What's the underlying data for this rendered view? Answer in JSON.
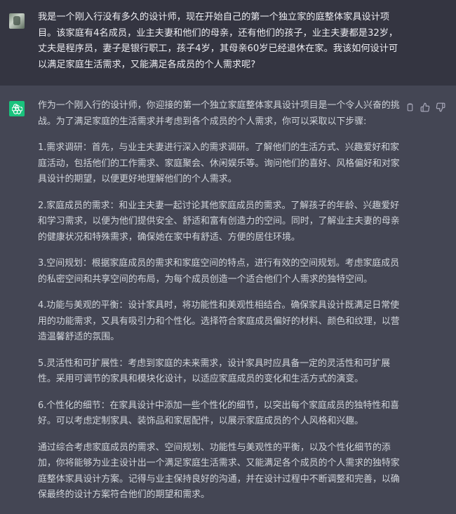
{
  "user_message": {
    "avatar": "user-avatar",
    "text": "我是一个刚入行没有多久的设计师，现在开始自己的第一个独立家的庭整体家具设计项目。该家庭有4名成员，业主夫妻和他们的母亲，还有他们的孩子，业主夫妻都是32岁，丈夫是程序员，妻子是银行职工，孩子4岁，其母亲60岁已经退休在家。我该如何设计可以满足家庭生活需求，又能满足各成员的个人需求呢?"
  },
  "assistant_message": {
    "avatar": "openai-logo",
    "paragraphs": [
      "作为一个刚入行的设计师，你迎接的第一个独立家庭整体家具设计项目是一个令人兴奋的挑战。为了满足家庭的生活需求并考虑到各个成员的个人需求，你可以采取以下步骤:",
      "1.需求调研：首先，与业主夫妻进行深入的需求调研。了解他们的生活方式、兴趣爱好和家庭活动，包括他们的工作需求、家庭聚会、休闲娱乐等。询问他们的喜好、风格偏好和对家具设计的期望，以便更好地理解他们的个人需求。",
      "2.家庭成员的需求：和业主夫妻一起讨论其他家庭成员的需求。了解孩子的年龄、兴趣爱好和学习需求，以便为他们提供安全、舒适和富有创造力的空间。同时，了解业主夫妻的母亲的健康状况和特殊需求，确保她在家中有舒适、方便的居住环境。",
      "3.空间规划：根据家庭成员的需求和家庭空间的特点，进行有效的空间规划。考虑家庭成员的私密空间和共享空间的布局，为每个成员创造一个适合他们个人需求的独特空间。",
      "4.功能与美观的平衡：设计家具时，将功能性和美观性相结合。确保家具设计既满足日常使用的功能需求，又具有吸引力和个性化。选择符合家庭成员偏好的材料、颜色和纹理，以营造温馨舒适的氛围。",
      "5.灵活性和可扩展性：考虑到家庭的未来需求，设计家具时应具备一定的灵活性和可扩展性。采用可调节的家具和模块化设计，以适应家庭成员的变化和生活方式的演变。",
      "6.个性化的细节：在家具设计中添加一些个性化的细节，以突出每个家庭成员的独特性和喜好。可以考虑定制家具、装饰品和家居配件，以展示家庭成员的个人风格和兴趣。",
      "通过综合考虑家庭成员的需求、空间规划、功能性与美观性的平衡，以及个性化细节的添加，你将能够为业主设计出一个满足家庭生活需求、又能满足各个成员的个人需求的独特家庭整体家具设计方案。记得与业主保持良好的沟通，并在设计过程中不断调整和完善，以确保最终的设计方案符合他们的期望和需求。"
    ],
    "actions": [
      "copy-icon",
      "thumbs-up-icon",
      "thumbs-down-icon"
    ]
  },
  "colors": {
    "user_bg": "#343541",
    "assistant_bg": "#444654",
    "accent": "#19c37d",
    "text": "#d1d5db"
  }
}
